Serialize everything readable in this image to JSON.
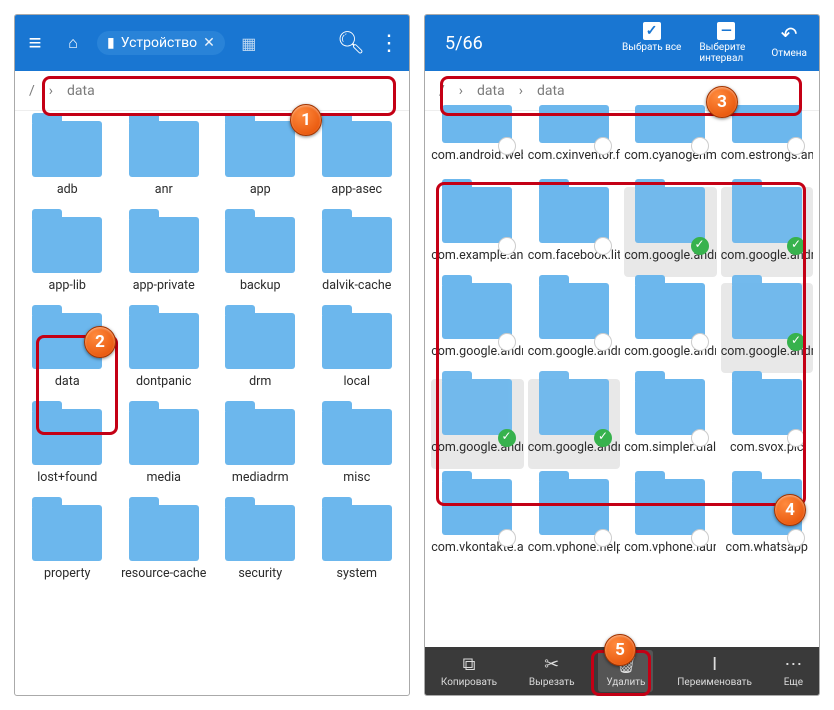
{
  "left": {
    "location_chip": "Устройство",
    "breadcrumb": [
      "/",
      "data"
    ],
    "folders": [
      "adb",
      "anr",
      "app",
      "app-asec",
      "app-lib",
      "app-private",
      "backup",
      "dalvik-cache",
      "data",
      "dontpanic",
      "drm",
      "local",
      "lost+found",
      "media",
      "mediadrm",
      "misc",
      "property",
      "resource-cache",
      "security",
      "system"
    ]
  },
  "right": {
    "selection_count": "5/66",
    "top_actions": {
      "select_all": "Выбрать все",
      "select_range": "Выберите интервал",
      "cancel": "Отмена"
    },
    "breadcrumb": [
      "/",
      "data",
      "data"
    ],
    "row_partial": [
      "com.android.webview",
      "com.cxinventor.file.explor",
      "com.cyanogenmod.filem",
      "com.estrongs.android.po"
    ],
    "items": [
      {
        "label": "com.example.android.sof",
        "sel": false,
        "chk": true
      },
      {
        "label": "com.facebook.lite",
        "sel": false,
        "chk": true
      },
      {
        "label": "com.google.android.apps",
        "sel": true,
        "chk": true
      },
      {
        "label": "com.google.android.gms",
        "sel": true,
        "chk": true
      },
      {
        "label": "com.google.android.gsf",
        "sel": false,
        "chk": true
      },
      {
        "label": "com.google.android.gsf.l",
        "sel": false,
        "chk": true
      },
      {
        "label": "com.google.android.insta",
        "sel": false,
        "chk": true
      },
      {
        "label": "com.google.android.mus",
        "sel": true,
        "chk": true
      },
      {
        "label": "com.google.android.play",
        "sel": true,
        "chk": true
      },
      {
        "label": "com.google.android.vide",
        "sel": true,
        "chk": true
      },
      {
        "label": "com.simpler.dialer",
        "sel": false,
        "chk": true
      },
      {
        "label": "com.svox.pic",
        "sel": false,
        "chk": true
      }
    ],
    "row_bottom": [
      "com.vkontakte.android",
      "com.vphone.helper",
      "com.vphone.launcher",
      "com.whatsapp"
    ],
    "bottom_actions": {
      "copy": "Копировать",
      "cut": "Вырезать",
      "delete": "Удалить",
      "rename": "Переименовать",
      "more": "Еще"
    }
  },
  "callouts": {
    "1": "1",
    "2": "2",
    "3": "3",
    "4": "4",
    "5": "5"
  }
}
